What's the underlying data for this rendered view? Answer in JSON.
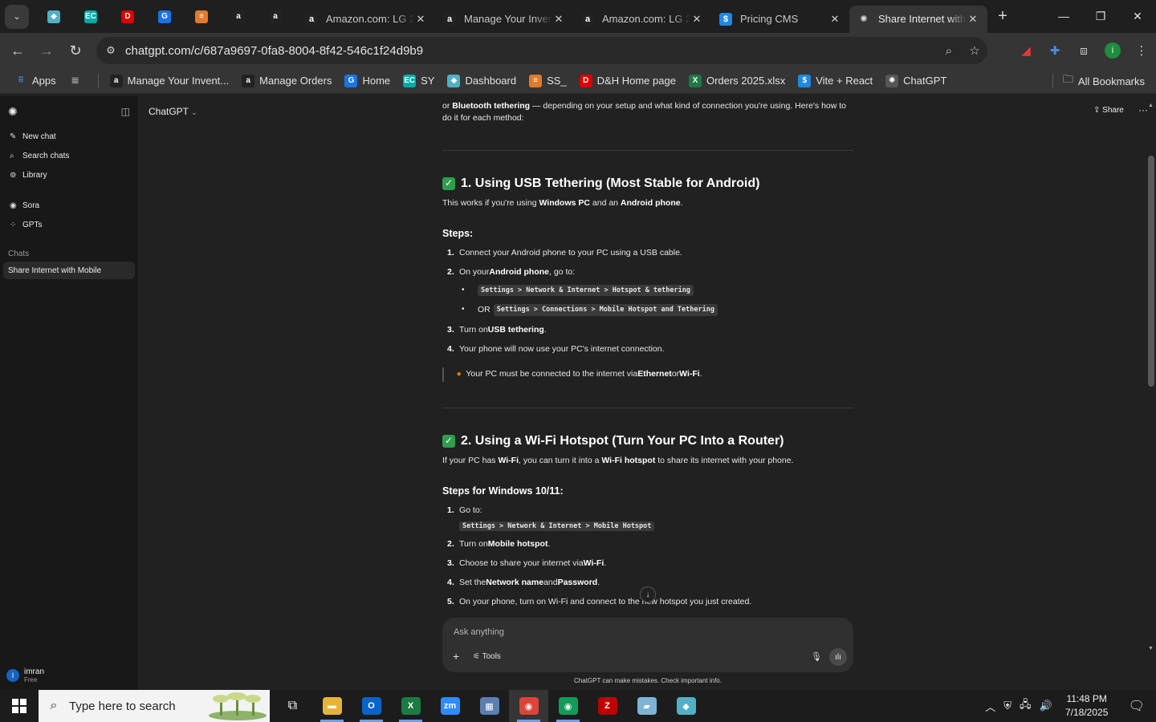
{
  "browser": {
    "pinned_tabs": [
      {
        "icon": "aqua-diamond-icon",
        "color": "#4fb0c6",
        "glyph": "◆"
      },
      {
        "icon": "ec-icon",
        "color": "#0aa",
        "glyph": "EC"
      },
      {
        "icon": "dh-icon",
        "color": "#d00",
        "glyph": "D"
      },
      {
        "icon": "store-icon",
        "color": "#1a73e8",
        "glyph": "G"
      },
      {
        "icon": "stack-icon",
        "color": "#e07a2c",
        "glyph": "≡"
      },
      {
        "icon": "amazon-icon",
        "color": "#222",
        "glyph": "a"
      },
      {
        "icon": "amazon-icon",
        "color": "#222",
        "glyph": "a"
      }
    ],
    "tabs": [
      {
        "title": "Amazon.com: LG 2",
        "fav": "a",
        "favcolor": "#fff",
        "favbg": "#222"
      },
      {
        "title": "Manage Your Inven",
        "fav": "a",
        "favcolor": "#fff",
        "favbg": "#222"
      },
      {
        "title": "Amazon.com: LG 2",
        "fav": "a",
        "favcolor": "#fff",
        "favbg": "#222"
      },
      {
        "title": "Pricing CMS",
        "fav": "$",
        "favcolor": "#fff",
        "favbg": "#1e88e5"
      },
      {
        "title": "Share Internet with",
        "fav": "✺",
        "favcolor": "#ddd",
        "favbg": "transparent"
      }
    ],
    "url": "chatgpt.com/c/687a9697-0fa8-8004-8f42-546c1f24d9b9",
    "bookmarks": [
      {
        "label": "Apps",
        "icon": "apps-grid-icon",
        "color": "#4285f4",
        "glyph": "⠿"
      },
      {
        "label": "",
        "icon": "tab-groups-icon",
        "color": "#9aa0a6",
        "glyph": "▦"
      },
      {
        "label": "Manage Your Invent...",
        "icon": "amazon-icon",
        "color": "#222",
        "glyph": "a"
      },
      {
        "label": "Manage Orders",
        "icon": "amazon-icon",
        "color": "#222",
        "glyph": "a"
      },
      {
        "label": "Home",
        "icon": "store-icon",
        "color": "#1a73e8",
        "glyph": "G"
      },
      {
        "label": "SY",
        "icon": "ec-icon",
        "color": "#0aa",
        "glyph": "EC"
      },
      {
        "label": "Dashboard",
        "icon": "dashboard-icon",
        "color": "#4fb0c6",
        "glyph": "◆"
      },
      {
        "label": "SS_",
        "icon": "stack-icon",
        "color": "#e07a2c",
        "glyph": "≡"
      },
      {
        "label": "D&H Home page",
        "icon": "dh-icon",
        "color": "#d00",
        "glyph": "D"
      },
      {
        "label": "Orders 2025.xlsx",
        "icon": "excel-icon",
        "color": "#1d7a43",
        "glyph": "X"
      },
      {
        "label": "Vite + React",
        "icon": "dollar-icon",
        "color": "#1e88e5",
        "glyph": "$"
      },
      {
        "label": "ChatGPT",
        "icon": "chatgpt-icon",
        "color": "#555",
        "glyph": "✺"
      }
    ],
    "all_bookmarks": "All Bookmarks"
  },
  "sidebar": {
    "items": [
      {
        "label": "New chat",
        "icon": "✎"
      },
      {
        "label": "Search chats",
        "icon": "⌕"
      },
      {
        "label": "Library",
        "icon": "⊚"
      }
    ],
    "items2": [
      {
        "label": "Sora",
        "icon": "◉"
      },
      {
        "label": "GPTs",
        "icon": "⁘"
      }
    ],
    "chats_label": "Chats",
    "active_chat": "Share Internet with Mobile",
    "user_name": "imran",
    "user_plan": "Free",
    "avatar": "I"
  },
  "main": {
    "model": "ChatGPT",
    "share": "Share",
    "intro_1": "or ",
    "intro_b1": "Bluetooth tethering",
    "intro_2": " — depending on your setup and what kind of connection you're using. Here's how to",
    "intro_3": "do it for each method:",
    "s1_title": "1. Using USB Tethering (Most Stable for Android)",
    "s1_desc_1": "This works if you're using ",
    "s1_desc_b1": "Windows PC",
    "s1_desc_2": " and an ",
    "s1_desc_b2": "Android phone",
    "s1_desc_3": ".",
    "s1_steps": "Steps:",
    "s1_step1": "Connect your Android phone to your PC using a USB cable.",
    "s1_step2_1": "On your ",
    "s1_step2_b": "Android phone",
    "s1_step2_2": ", go to:",
    "s1_code1": "Settings > Network & Internet > Hotspot & tethering",
    "s1_or": "OR",
    "s1_code2": "Settings > Connections > Mobile Hotspot and Tethering",
    "s1_step3_1": "Turn on ",
    "s1_step3_b": "USB tethering",
    "s1_step3_2": ".",
    "s1_step4": "Your phone will now use your PC's internet connection.",
    "s1_note_1": "Your PC must be connected to the internet via ",
    "s1_note_b1": "Ethernet",
    "s1_note_2": " or ",
    "s1_note_b2": "Wi-Fi",
    "s1_note_3": ".",
    "s2_title": "2. Using a Wi-Fi Hotspot (Turn Your PC Into a Router)",
    "s2_desc_1": "If your PC has ",
    "s2_desc_b1": "Wi-Fi",
    "s2_desc_2": ", you can turn it into a ",
    "s2_desc_b2": "Wi-Fi hotspot",
    "s2_desc_3": " to share its internet with your phone.",
    "s2_steps": "Steps for Windows 10/11:",
    "s2_step1": "Go to:",
    "s2_code": "Settings > Network & Internet > Mobile Hotspot",
    "s2_step2_1": "Turn on ",
    "s2_step2_b": "Mobile hotspot",
    "s2_step2_2": ".",
    "s2_step3_1": "Choose to share your internet via ",
    "s2_step3_b": "Wi-Fi",
    "s2_step3_2": ".",
    "s2_step4_1": "Set the ",
    "s2_step4_b1": "Network name",
    "s2_step4_2": " and ",
    "s2_step4_b2": "Password",
    "s2_step4_3": ".",
    "s2_step5": "On your phone, turn on Wi-Fi and connect to the new hotspot you just created.",
    "composer_placeholder": "Ask anything",
    "tools": "Tools",
    "disclaimer": "ChatGPT can make mistakes. Check important info."
  },
  "taskbar": {
    "search_placeholder": "Type here to search",
    "apps": [
      {
        "icon": "task-view-icon",
        "color": "transparent",
        "glyph": "⧉",
        "open": false
      },
      {
        "icon": "file-explorer-icon",
        "color": "#e8b33a",
        "glyph": "▬",
        "open": true
      },
      {
        "icon": "outlook-icon",
        "color": "#0a64c8",
        "glyph": "O",
        "open": true
      },
      {
        "icon": "excel-icon",
        "color": "#1d7a43",
        "glyph": "X",
        "open": true
      },
      {
        "icon": "zoom-icon",
        "color": "#2d8cff",
        "glyph": "zm",
        "open": false
      },
      {
        "icon": "calculator-icon",
        "color": "#5a7fb0",
        "glyph": "▦",
        "open": false
      },
      {
        "icon": "chrome-icon",
        "color": "#db4437",
        "glyph": "◉",
        "open": true
      },
      {
        "icon": "chrome-icon",
        "color": "#0f9d58",
        "glyph": "◉",
        "open": true
      },
      {
        "icon": "filezilla-icon",
        "color": "#bf0000",
        "glyph": "Z",
        "open": false
      },
      {
        "icon": "notepad-icon",
        "color": "#7fb3d5",
        "glyph": "▰",
        "open": false
      },
      {
        "icon": "app-diamond-icon",
        "color": "#4fb0c6",
        "glyph": "◆",
        "open": false
      }
    ],
    "time": "11:48 PM",
    "date": "7/18/2025"
  }
}
